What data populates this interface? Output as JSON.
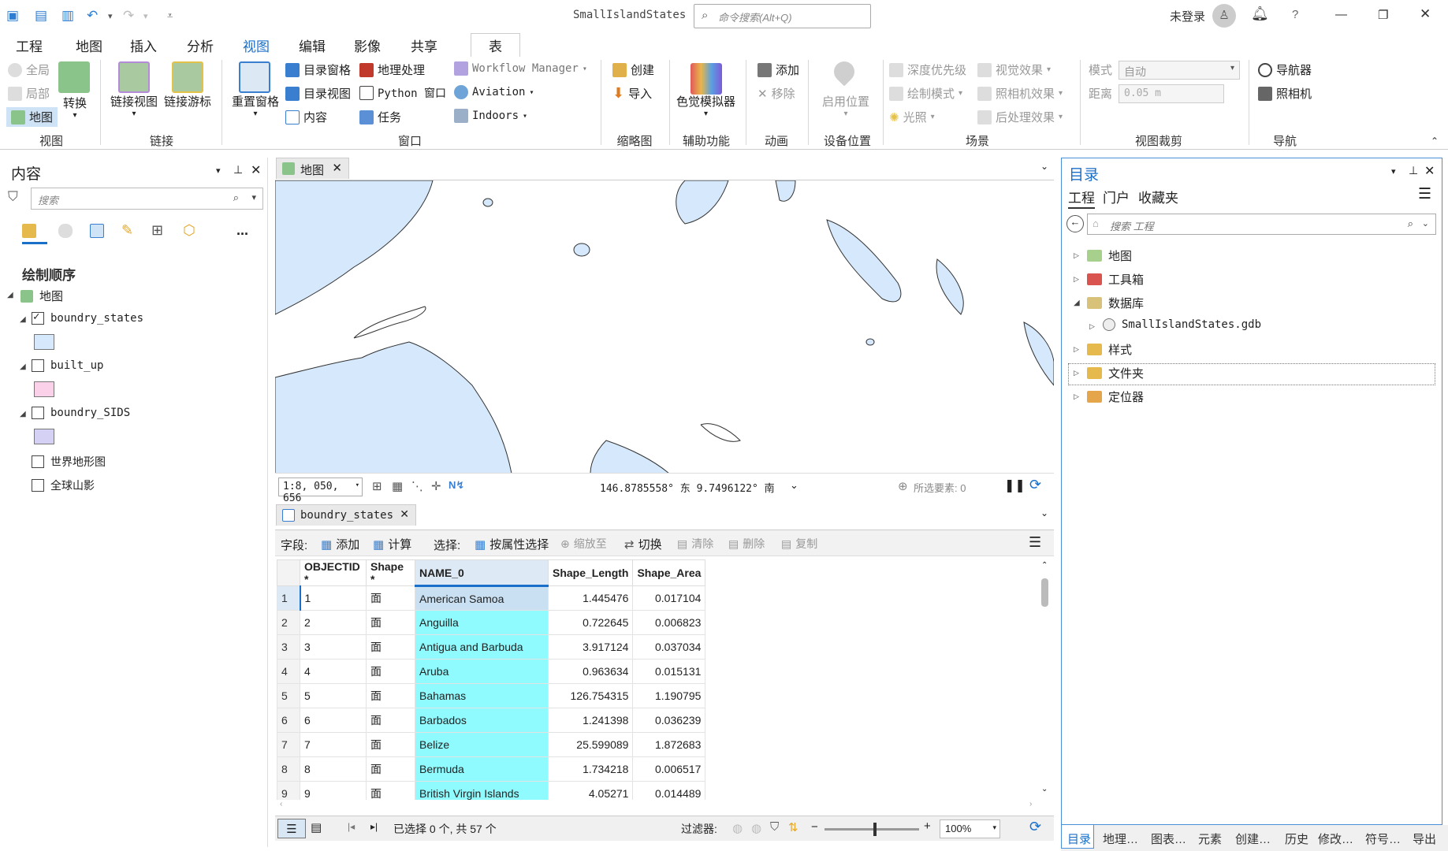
{
  "window": {
    "title": "SmallIslandStates",
    "command_search_placeholder": "命令搜索(Alt+Q)",
    "login": "未登录",
    "help": "?"
  },
  "ribbon_tabs": [
    "工程",
    "地图",
    "插入",
    "分析",
    "视图",
    "编辑",
    "影像",
    "共享",
    "表"
  ],
  "active_tab": "视图",
  "ribbon": {
    "view": {
      "full_extent": "全局",
      "local": "局部",
      "convert": "转换",
      "map": "地图",
      "group": "视图"
    },
    "link": {
      "link_views": "链接视图",
      "link_navigation": "链接游标",
      "group": "链接"
    },
    "window": {
      "reset_panes": "重置窗格",
      "catalog_pane": "目录窗格",
      "catalog_view": "目录视图",
      "contents": "内容",
      "geoprocessing": "地理处理",
      "python_window": "Python 窗口",
      "tasks": "任务",
      "workflow_manager": "Workflow Manager",
      "aviation": "Aviation",
      "indoors": "Indoors",
      "group": "窗口"
    },
    "overview": {
      "create": "创建",
      "import": "导入",
      "group": "缩略图"
    },
    "accessibility": {
      "color_vision": "色觉模拟器",
      "group": "辅助功能"
    },
    "animation": {
      "add": "添加",
      "remove": "移除",
      "group": "动画"
    },
    "device_location": {
      "enable": "启用位置",
      "group": "设备位置"
    },
    "scene": {
      "depth_priority": "深度优先级",
      "draw_mode": "绘制模式",
      "illumination": "光照",
      "visual_effects": "视觉效果",
      "camera_effects": "照相机效果",
      "post_processing": "后处理效果",
      "group": "场景"
    },
    "view_clipping": {
      "mode_label": "模式",
      "mode_value": "自动",
      "distance_label": "距离",
      "distance_value": "0.05  m",
      "group": "视图裁剪"
    },
    "navigate": {
      "navigator": "导航器",
      "camera": "照相机",
      "group": "导航"
    }
  },
  "contents_pane": {
    "title": "内容",
    "search_placeholder": "搜索",
    "section": "绘制顺序",
    "map_name": "地图",
    "layers": [
      {
        "name": "boundry_states",
        "checked": true,
        "color": "#d6e8fb"
      },
      {
        "name": "built_up",
        "checked": false,
        "color": "#fbd1ea"
      },
      {
        "name": "boundry_SIDS",
        "checked": false,
        "color": "#d4d1f5"
      },
      {
        "name": "世界地形图",
        "checked": false
      },
      {
        "name": "全球山影",
        "checked": false
      }
    ],
    "more": "..."
  },
  "map_view": {
    "tab_label": "地图",
    "scale": "1:8, 050, 656",
    "coordinates": "146.8785558° 东  9.7496122° 南",
    "selected_features": "所选要素: 0"
  },
  "table_view": {
    "tab_label": "boundry_states",
    "toolbar": {
      "field_label": "字段:",
      "add": "添加",
      "calculate": "计算",
      "selection_label": "选择:",
      "select_by_attr": "按属性选择",
      "zoom_to": "缩放至",
      "switch": "切换",
      "clear": "清除",
      "delete": "删除",
      "copy": "复制"
    },
    "columns": [
      "OBJECTID *",
      "Shape *",
      "NAME_0",
      "Shape_Length",
      "Shape_Area"
    ],
    "rows": [
      [
        "1",
        "1",
        "面",
        "American Samoa",
        "1.445476",
        "0.017104"
      ],
      [
        "2",
        "2",
        "面",
        "Anguilla",
        "0.722645",
        "0.006823"
      ],
      [
        "3",
        "3",
        "面",
        "Antigua and Barbuda",
        "3.917124",
        "0.037034"
      ],
      [
        "4",
        "4",
        "面",
        "Aruba",
        "0.963634",
        "0.015131"
      ],
      [
        "5",
        "5",
        "面",
        "Bahamas",
        "126.754315",
        "1.190795"
      ],
      [
        "6",
        "6",
        "面",
        "Barbados",
        "1.241398",
        "0.036239"
      ],
      [
        "7",
        "7",
        "面",
        "Belize",
        "25.599089",
        "1.872683"
      ],
      [
        "8",
        "8",
        "面",
        "Bermuda",
        "1.734218",
        "0.006517"
      ],
      [
        "9",
        "9",
        "面",
        "British Virgin Islands",
        "4.05271",
        "0.014489"
      ]
    ],
    "status": "已选择 0 个, 共 57 个",
    "filter_label": "过滤器:",
    "zoom": "100%"
  },
  "catalog_pane": {
    "title": "目录",
    "tabs": [
      "工程",
      "门户",
      "收藏夹"
    ],
    "search_placeholder": "搜索 工程",
    "items": [
      "地图",
      "工具箱",
      "数据库",
      "SmallIslandStates.gdb",
      "样式",
      "文件夹",
      "定位器"
    ],
    "bottom_tabs": [
      "目录",
      "地理…",
      "图表…",
      "元素",
      "创建…",
      "历史",
      "修改…",
      "符号…",
      "导出"
    ]
  },
  "colors": {
    "accent": "#1a6fc9",
    "water": "#d6e8fb",
    "selection_cyan": "#8ffbff"
  }
}
